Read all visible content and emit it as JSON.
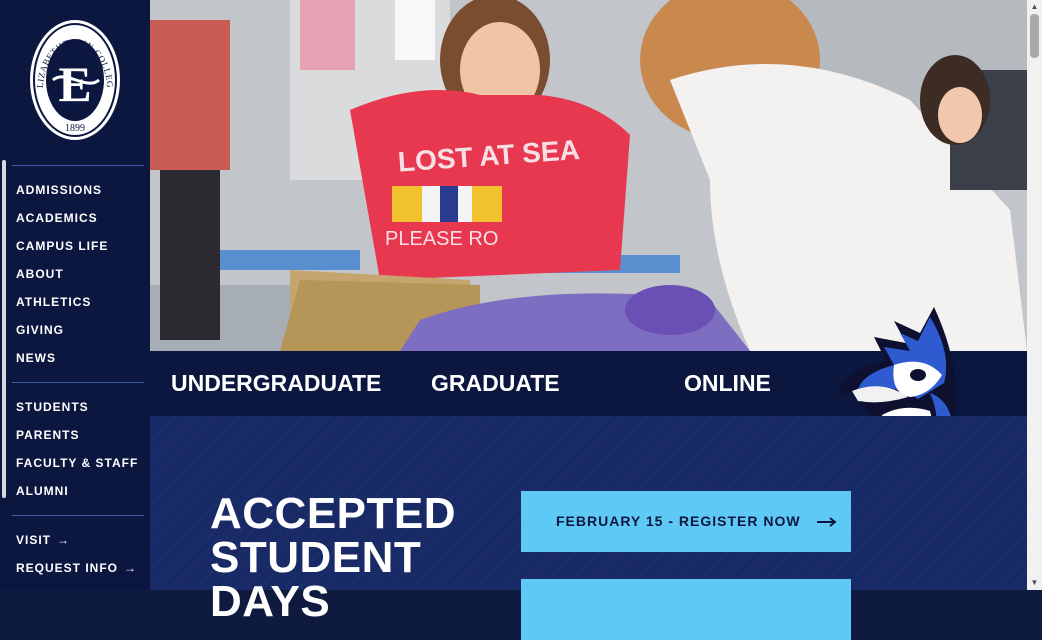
{
  "logo": {
    "alt": "Elizabethtown College 1899 seal",
    "arc_text": "ELIZABETHTOWN COLLEGE",
    "year": "1899",
    "monogram": "E"
  },
  "nav": {
    "primary": [
      "ADMISSIONS",
      "ACADEMICS",
      "CAMPUS LIFE",
      "ABOUT",
      "ATHLETICS",
      "GIVING",
      "NEWS"
    ],
    "audience": [
      "STUDENTS",
      "PARENTS",
      "FACULTY & STAFF",
      "ALUMNI"
    ],
    "actions": [
      {
        "label": "VISIT",
        "arrow": "→"
      },
      {
        "label": "REQUEST INFO",
        "arrow": "→"
      }
    ]
  },
  "hero": {
    "shirt_text": "LOST AT SEA",
    "shirt_text_2": "PLEASE RO"
  },
  "tabs": [
    "UNDERGRADUATE",
    "GRADUATE",
    "ONLINE"
  ],
  "main": {
    "heading_lines": [
      "ACCEPTED",
      "STUDENT",
      "DAYS"
    ],
    "cta_primary": "FEBRUARY 15 - REGISTER NOW"
  },
  "colors": {
    "navy": "#0c1740",
    "section_blue": "#182a66",
    "accent_cyan": "#5fc9f5",
    "divider": "#3d58a6",
    "shirt_red": "#e8384f"
  },
  "icons": {
    "cta_arrow": "long-arrow-right-icon",
    "mascot": "blue-jay-mascot",
    "scroll_up": "▲",
    "scroll_down": "▼"
  }
}
